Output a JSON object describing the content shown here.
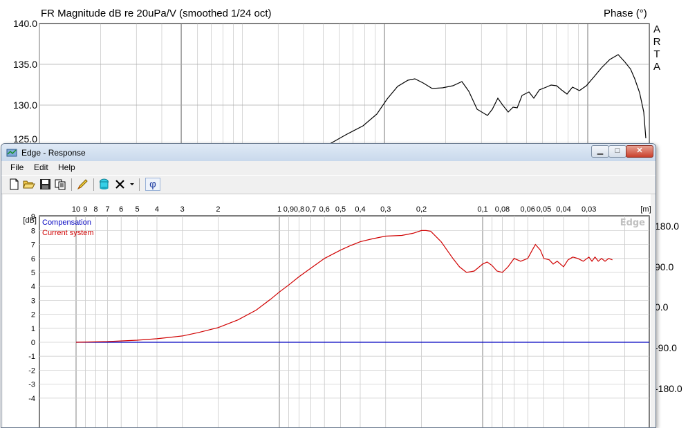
{
  "background_chart": {
    "title": "FR Magnitude dB re 20uPa/V (smoothed 1/24 oct)",
    "right_axis_title": "Phase (°)",
    "watermark_letters": [
      "A",
      "R",
      "T",
      "A"
    ],
    "y_ticks": [
      "140.0",
      "135.0",
      "130.0",
      "125.0"
    ],
    "right_ticks": [
      "180.0",
      "90.0",
      "0.0",
      "-90.0",
      "-180.0"
    ]
  },
  "window": {
    "title": "Edge - Response",
    "controls": {
      "minimize": "▁",
      "maximize": "□",
      "close": "✕"
    },
    "menu": [
      "File",
      "Edit",
      "Help"
    ],
    "toolbar_icons": [
      "new-file-icon",
      "open-folder-icon",
      "save-icon",
      "copy-icon",
      "pencil-icon",
      "speaker-icon",
      "delete-icon",
      "dropdown-arrow-icon",
      "phi-icon"
    ],
    "toolbar_phi": "φ"
  },
  "chart_data": [
    {
      "type": "line",
      "title": "",
      "ylabel": "[dB]",
      "xlabel": "[m]",
      "ylim": [
        -4.5,
        9.5
      ],
      "x_axis_direction": "decreasing-log",
      "x_ticks": [
        "10",
        "9",
        "8",
        "7",
        "6",
        "5",
        "4",
        "3",
        "2",
        "1",
        "0,9",
        "0,8",
        "0,7",
        "0,6",
        "0,5",
        "0,4",
        "0,3",
        "0,2",
        "0,1",
        "0,08",
        "0,06",
        "0,05",
        "0,04",
        "0,03"
      ],
      "y_ticks": [
        "9",
        "8",
        "7",
        "6",
        "5",
        "4",
        "3",
        "2",
        "1",
        "0",
        "-1",
        "-2",
        "-3",
        "-4"
      ],
      "grid": true,
      "legend_placement": "top-left",
      "watermark": "Edge",
      "colors": {
        "compensation": "#0000c0",
        "current": "#d00000"
      },
      "series": [
        {
          "name": "Compensation",
          "x": [
            10,
            0.023
          ],
          "y": [
            0,
            0
          ]
        },
        {
          "name": "Current system",
          "x": [
            10,
            7,
            5,
            4,
            3,
            2.5,
            2,
            1.6,
            1.3,
            1.1,
            1,
            0.9,
            0.8,
            0.7,
            0.6,
            0.5,
            0.45,
            0.4,
            0.35,
            0.3,
            0.25,
            0.22,
            0.2,
            0.19,
            0.18,
            0.16,
            0.14,
            0.13,
            0.12,
            0.11,
            0.1,
            0.095,
            0.09,
            0.085,
            0.08,
            0.075,
            0.07,
            0.065,
            0.06,
            0.057,
            0.055,
            0.052,
            0.05,
            0.047,
            0.045,
            0.043,
            0.04,
            0.038,
            0.036,
            0.034,
            0.032,
            0.03,
            0.029,
            0.028,
            0.027,
            0.026,
            0.025,
            0.024,
            0.023
          ],
          "y": [
            0,
            0.05,
            0.15,
            0.25,
            0.45,
            0.7,
            1.05,
            1.6,
            2.3,
            3.1,
            3.6,
            4.1,
            4.7,
            5.3,
            6.0,
            6.6,
            6.9,
            7.2,
            7.4,
            7.6,
            7.65,
            7.8,
            8.0,
            8.0,
            7.95,
            7.2,
            6.0,
            5.4,
            5.0,
            5.1,
            5.6,
            5.75,
            5.5,
            5.1,
            5.0,
            5.4,
            6.0,
            5.8,
            6.0,
            6.6,
            7.0,
            6.6,
            6.0,
            5.9,
            5.6,
            5.8,
            5.4,
            5.9,
            6.1,
            6.0,
            5.8,
            6.1,
            5.8,
            6.1,
            5.8,
            6.0,
            5.8,
            6.0,
            5.9
          ]
        }
      ],
      "right_axis_ticks": [
        "180.0",
        "90.0",
        "0.0",
        "-90.0",
        "-180.0"
      ]
    }
  ]
}
